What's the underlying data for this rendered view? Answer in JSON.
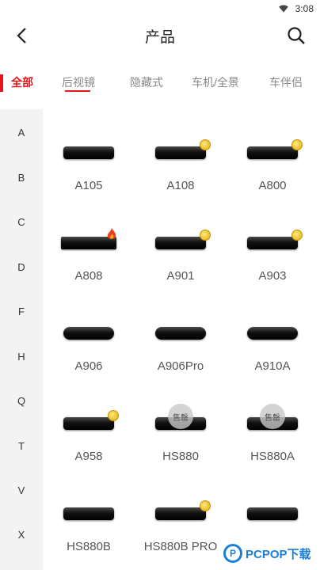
{
  "status": {
    "time": "3:08"
  },
  "app_bar": {
    "title": "产品",
    "back_icon": "back-chevron-icon",
    "search_icon": "search-icon"
  },
  "tabs": {
    "items": [
      "全部",
      "后视镜",
      "隐藏式",
      "车机/全景",
      "车伴侣"
    ],
    "active": "全部",
    "active_sub": "后视镜",
    "accent": "#e8141b"
  },
  "index_letters": [
    "A",
    "B",
    "C",
    "D",
    "F",
    "H",
    "Q",
    "T",
    "V",
    "X"
  ],
  "products": [
    {
      "name": "A105",
      "badge": "none"
    },
    {
      "name": "A108",
      "badge": "gold"
    },
    {
      "name": "A800",
      "badge": "gold"
    },
    {
      "name": "A808",
      "badge": "fire"
    },
    {
      "name": "A901",
      "badge": "gold"
    },
    {
      "name": "A903",
      "badge": "gold"
    },
    {
      "name": "A906",
      "badge": "none"
    },
    {
      "name": "A906Pro",
      "badge": "none"
    },
    {
      "name": "A910A",
      "badge": "none"
    },
    {
      "name": "A958",
      "badge": "gold"
    },
    {
      "name": "HS880",
      "badge": "sold",
      "badge_text": "售罄"
    },
    {
      "name": "HS880A",
      "badge": "sold",
      "badge_text": "售罄"
    },
    {
      "name": "HS880B",
      "badge": "none"
    },
    {
      "name": "HS880B PRO",
      "badge": "gold"
    },
    {
      "name": "",
      "badge": "none"
    }
  ],
  "watermark": {
    "text": "PCPOP下载"
  }
}
